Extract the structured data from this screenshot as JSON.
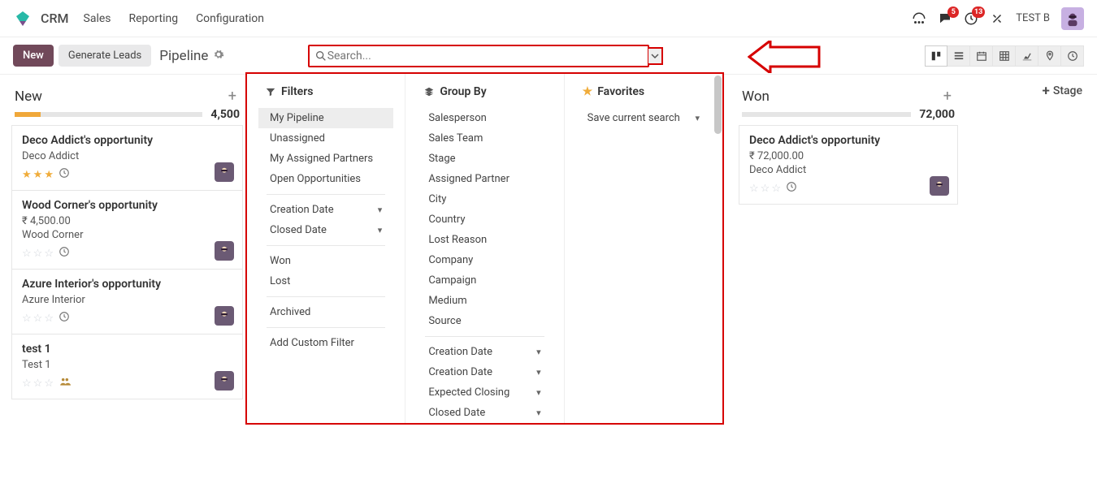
{
  "nav": {
    "brand": "CRM",
    "links": [
      "Sales",
      "Reporting",
      "Configuration"
    ],
    "badges": {
      "chat": "5",
      "clock": "13"
    },
    "user": "TEST B"
  },
  "ctrl": {
    "new": "New",
    "generate": "Generate Leads",
    "breadcrumb": "Pipeline",
    "search_placeholder": "Search...",
    "add_stage": "Stage"
  },
  "columns": {
    "new": {
      "title": "New",
      "total": "4,500",
      "bar_pct": 14,
      "cards": [
        {
          "title": "Deco Addict's opportunity",
          "sub1": "Deco Addict",
          "stars": 3,
          "clock": true
        },
        {
          "title": "Wood Corner's opportunity",
          "amount": "₹ 4,500.00",
          "sub1": "Wood Corner",
          "stars": 0,
          "clock": true
        },
        {
          "title": "Azure Interior's opportunity",
          "sub1": "Azure Interior",
          "stars": 0,
          "clock": true
        },
        {
          "title": "test 1",
          "sub1": "Test 1",
          "stars": 0,
          "group": true
        }
      ]
    },
    "won": {
      "title": "Won",
      "total": "72,000",
      "cards": [
        {
          "title": "Deco Addict's opportunity",
          "amount": "₹ 72,000.00",
          "sub1": "Deco Addict",
          "stars": 0,
          "clock": true
        }
      ]
    }
  },
  "dropdown": {
    "filters": {
      "head": "Filters",
      "items1": [
        "My Pipeline",
        "Unassigned",
        "My Assigned Partners",
        "Open Opportunities"
      ],
      "items2": [
        "Creation Date",
        "Closed Date"
      ],
      "items3": [
        "Won",
        "Lost"
      ],
      "items4": [
        "Archived"
      ],
      "items5": [
        "Add Custom Filter"
      ],
      "selected": "My Pipeline"
    },
    "groupby": {
      "head": "Group By",
      "items1": [
        "Salesperson",
        "Sales Team",
        "Stage",
        "Assigned Partner",
        "City",
        "Country",
        "Lost Reason",
        "Company",
        "Campaign",
        "Medium",
        "Source"
      ],
      "items2": [
        "Creation Date",
        "Creation Date",
        "Expected Closing",
        "Closed Date"
      ]
    },
    "favorites": {
      "head": "Favorites",
      "items": [
        "Save current search"
      ]
    }
  }
}
